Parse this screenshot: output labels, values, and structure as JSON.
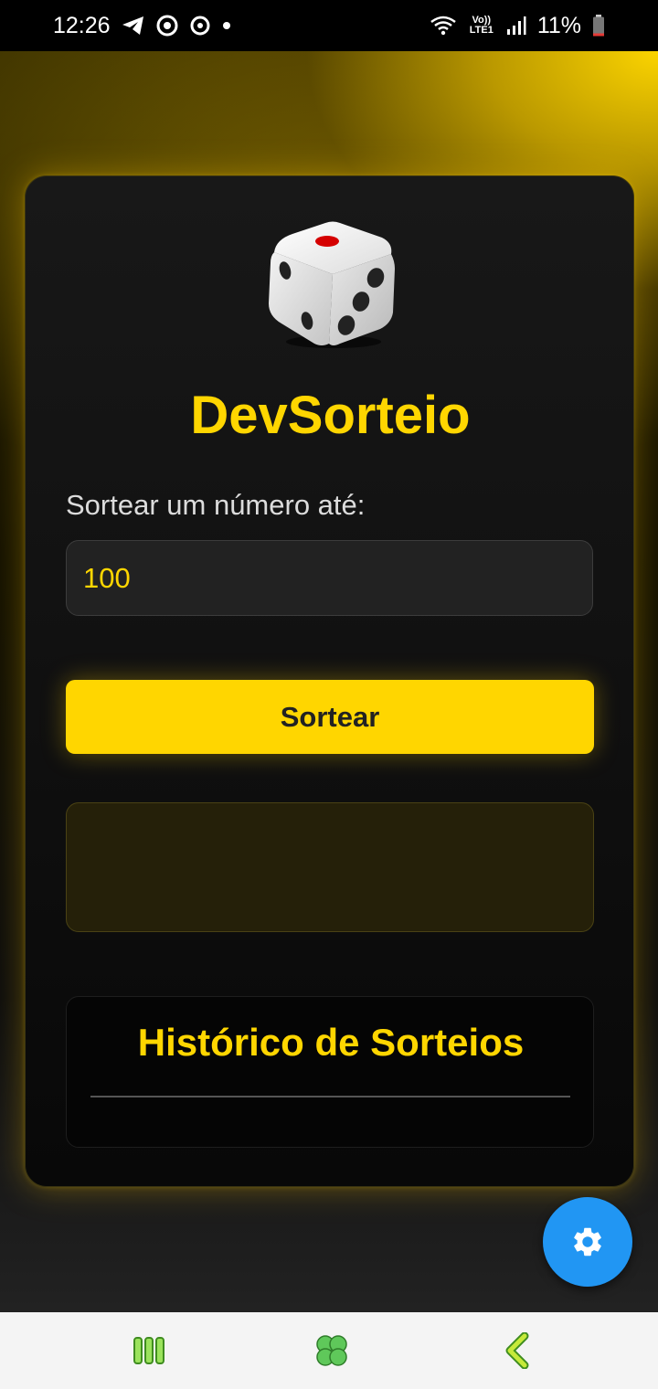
{
  "status_bar": {
    "time": "12:26",
    "left_icons": [
      "telegram-icon",
      "chrome-icon",
      "sync-icon",
      "dot-icon"
    ],
    "right_icons": [
      "wifi-icon",
      "volte-icon",
      "signal-icon"
    ],
    "network_label": "Vo)) LTE1",
    "battery_percent": "11%",
    "battery_level": 0.11
  },
  "app": {
    "title": "DevSorteio",
    "input_label": "Sortear um número até:",
    "input_value": "100",
    "draw_button_label": "Sortear",
    "result_text": "",
    "history_title": "Histórico de Sorteios",
    "history_items": [],
    "settings_icon": "gear-icon",
    "logo_icon": "dice-icon"
  },
  "nav_bar": {
    "items": [
      "recents-icon",
      "home-icon",
      "back-icon"
    ]
  },
  "colors": {
    "accent": "#FFD600",
    "fab": "#2196F3",
    "card": "#121212",
    "navbar": "#f4f4f4"
  }
}
